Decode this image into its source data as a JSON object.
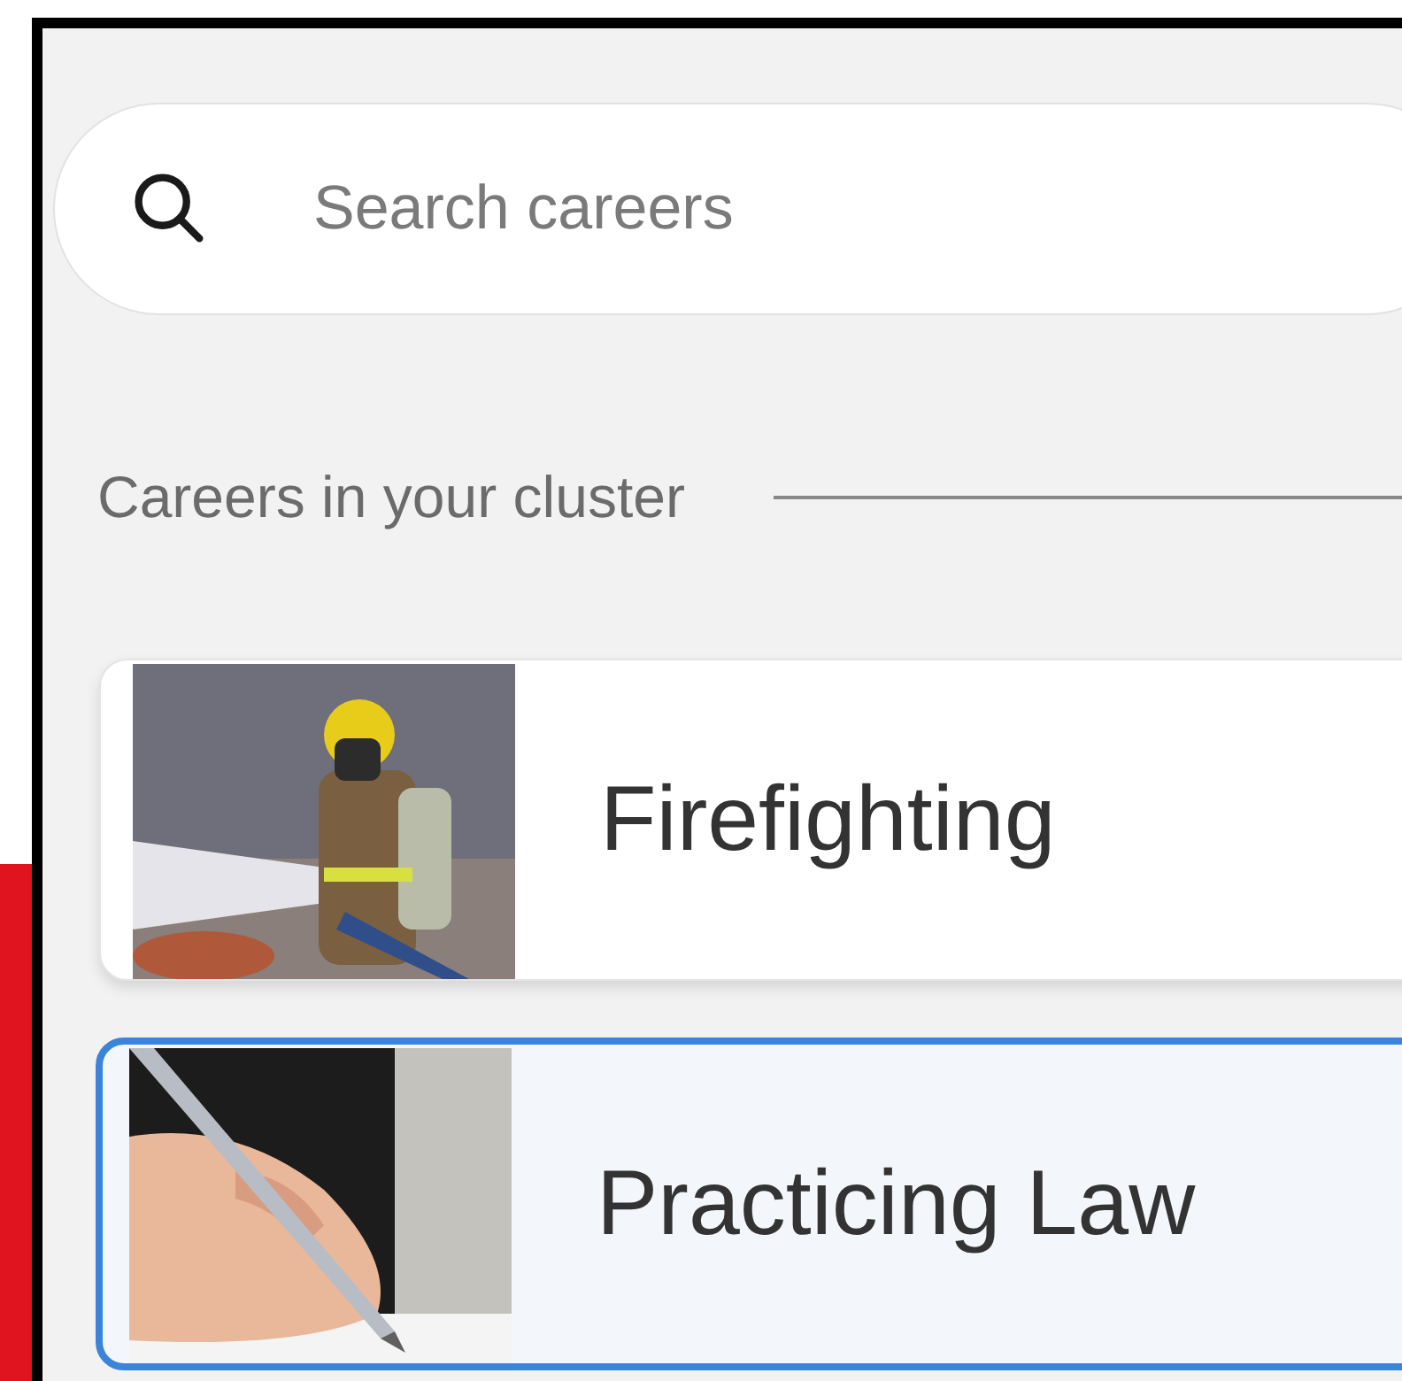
{
  "search": {
    "placeholder": "Search careers"
  },
  "section_heading": "Careers in your cluster",
  "careers": [
    {
      "title": "Firefighting",
      "selected": false
    },
    {
      "title": "Practicing Law",
      "selected": true
    }
  ]
}
